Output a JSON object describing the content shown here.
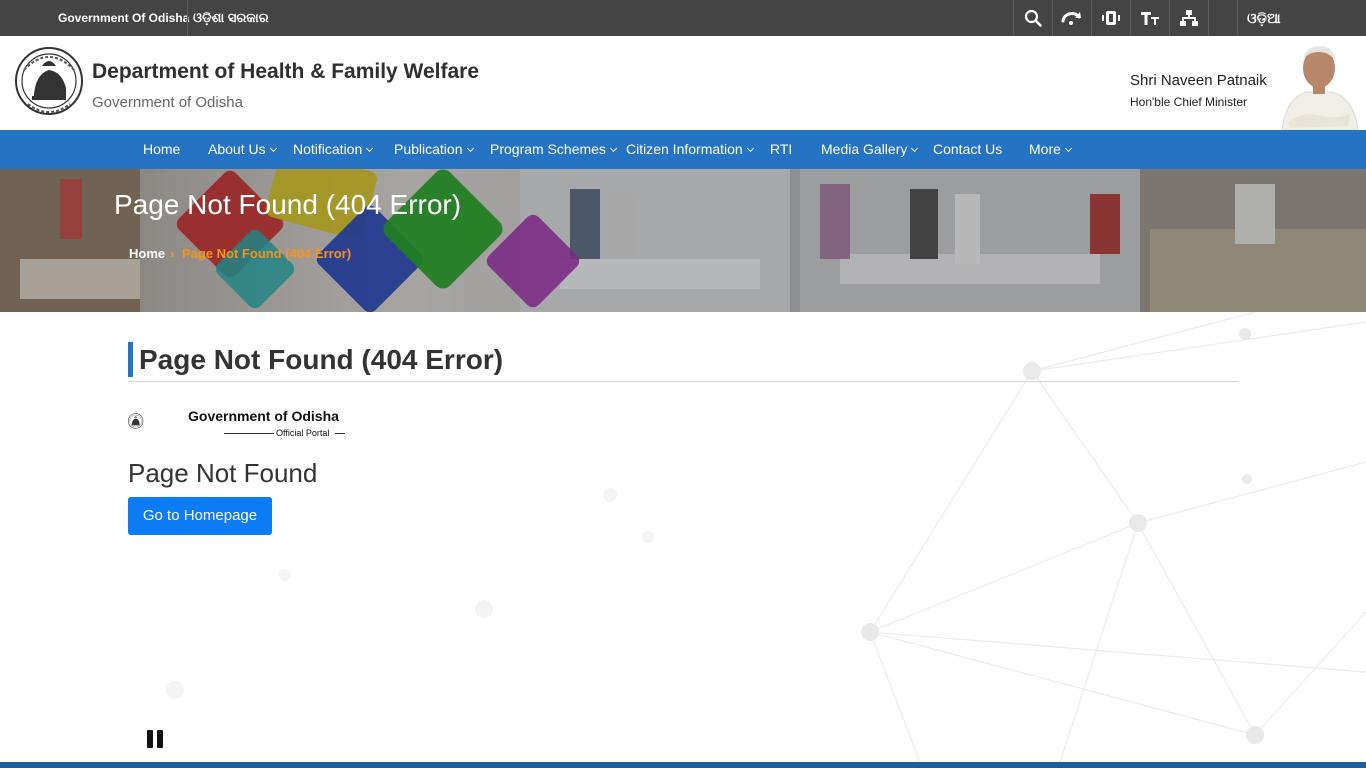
{
  "topbar": {
    "gov_en": "Government Of Odisha",
    "gov_od": "ଓଡ଼ିଶା ସରକାର",
    "tools": [
      {
        "name": "search-icon"
      },
      {
        "name": "skip-icon"
      },
      {
        "name": "contrast-icon"
      },
      {
        "name": "text-size-icon"
      },
      {
        "name": "sitemap-icon"
      }
    ],
    "language": "ଓଡ଼ିଆ"
  },
  "header": {
    "title": "Department of Health & Family Welfare",
    "subtitle": "Government of Odisha",
    "cm_name": "Shri Naveen Patnaik",
    "cm_title": "Hon'ble Chief Minister"
  },
  "nav": {
    "items": [
      {
        "label": "Home",
        "dropdown": false
      },
      {
        "label": "About Us",
        "dropdown": true
      },
      {
        "label": "Notification",
        "dropdown": true
      },
      {
        "label": "Publication",
        "dropdown": true
      },
      {
        "label": "Program Schemes",
        "dropdown": true
      },
      {
        "label": "Citizen Information",
        "dropdown": true
      },
      {
        "label": "RTI",
        "dropdown": false
      },
      {
        "label": "Media Gallery",
        "dropdown": true
      },
      {
        "label": "Contact Us",
        "dropdown": false
      },
      {
        "label": "More",
        "dropdown": true
      }
    ]
  },
  "banner": {
    "title": "Page Not Found (404 Error)",
    "breadcrumb": {
      "home": "Home",
      "separator": "›",
      "current": "Page Not Found (404 Error)"
    }
  },
  "content": {
    "heading": "Page Not Found (404 Error)",
    "logo_title": "Government of Odisha",
    "logo_sub": "Official Portal",
    "message": "Page Not Found",
    "button_label": "Go to Homepage"
  },
  "colors": {
    "topbar": "#444444",
    "nav": "#2573c3",
    "accent_orange": "#f7941d",
    "button": "#0d7bf3",
    "footer": "#1e5f99"
  }
}
